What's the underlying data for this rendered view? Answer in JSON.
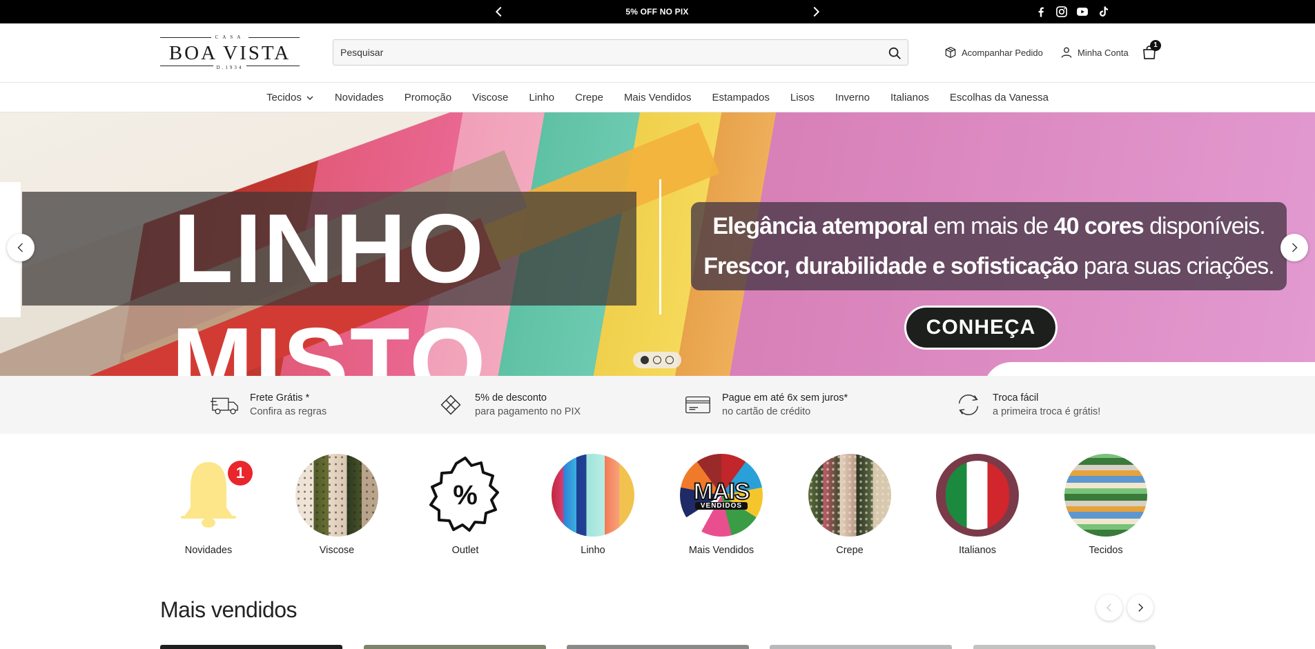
{
  "announcement": {
    "text": "5% OFF NO PIX"
  },
  "social": [
    "facebook-icon",
    "instagram-icon",
    "youtube-icon",
    "tiktok-icon"
  ],
  "logo": {
    "top": "CASA",
    "name": "BOA VISTA",
    "since": "D.1934"
  },
  "search": {
    "placeholder": "Pesquisar"
  },
  "header_links": {
    "track": "Acompanhar Pedido",
    "account": "Minha Conta",
    "cart_count": "1"
  },
  "nav": [
    "Tecidos",
    "Novidades",
    "Promoção",
    "Viscose",
    "Linho",
    "Crepe",
    "Mais Vendidos",
    "Estampados",
    "Lisos",
    "Inverno",
    "Italianos",
    "Escolhas da Vanessa"
  ],
  "hero": {
    "title": "LINHO MISTO",
    "tag1_bold_a": "Elegância atemporal",
    "tag1_mid": " em mais de ",
    "tag1_bold_b": "40 cores",
    "tag1_end": " disponíveis.",
    "tag2_bold": "Frescor, durabilidade e sofisticação",
    "tag2_end": " para suas criações.",
    "cta": "CONHEÇA",
    "slides": 3,
    "active_slide": 1
  },
  "benefits": [
    {
      "title": "Frete Grátis *",
      "subtitle": "Confira as regras",
      "icon": "truck-icon"
    },
    {
      "title": "5% de desconto",
      "subtitle": "para pagamento no PIX",
      "icon": "pix-icon"
    },
    {
      "title": "Pague em até 6x sem juros*",
      "subtitle": "no cartão de crédito",
      "icon": "credit-card-icon"
    },
    {
      "title": "Troca fácil",
      "subtitle": "a primeira troca é grátis!",
      "icon": "exchange-icon"
    }
  ],
  "categories": [
    {
      "label": "Novidades",
      "badge": "1",
      "mais_text": ""
    },
    {
      "label": "Viscose"
    },
    {
      "label": "Outlet",
      "symbol": "%"
    },
    {
      "label": "Linho"
    },
    {
      "label": "Mais Vendidos",
      "mais_text": "MAIS",
      "mais_sub": "VENDIDOS"
    },
    {
      "label": "Crepe"
    },
    {
      "label": "Italianos"
    },
    {
      "label": "Tecidos"
    }
  ],
  "section": {
    "title": "Mais vendidos"
  },
  "colors": {
    "topbar": "#000000",
    "accent": "#111111",
    "badge_red": "#e8262c",
    "bell": "#fde68a"
  }
}
